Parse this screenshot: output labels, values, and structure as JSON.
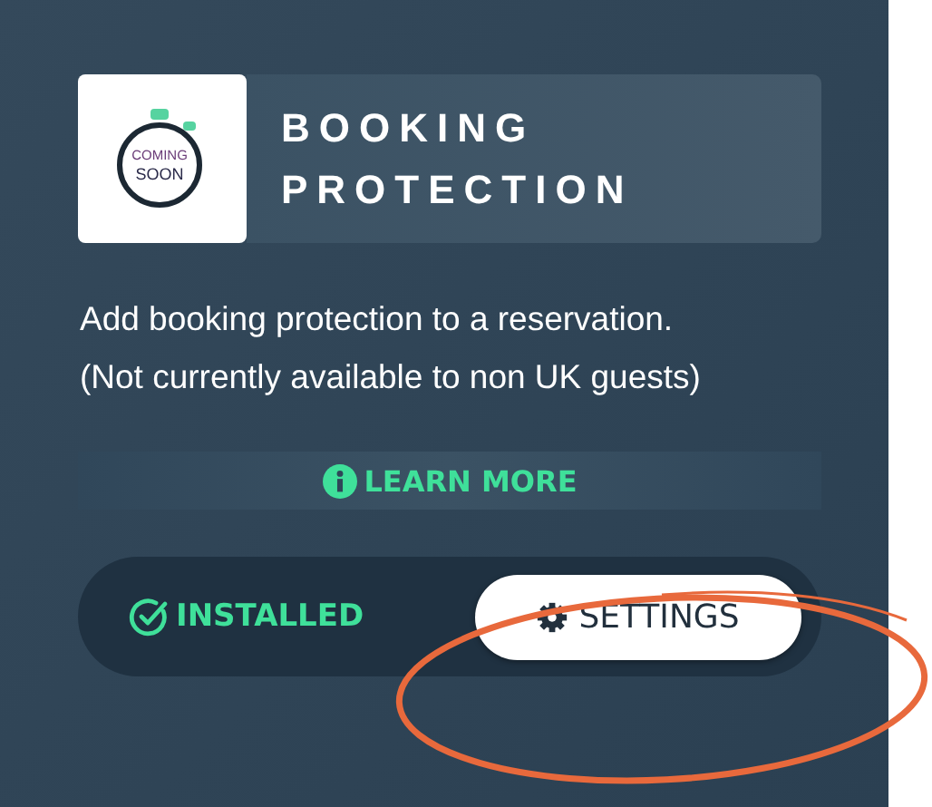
{
  "card": {
    "logo": {
      "line_1": "COMING",
      "line_2": "SOON"
    },
    "title": "BOOKING PROTECTION",
    "description": "Add booking protection to a reservation. (Not currently available to non UK guests)",
    "learn_more": {
      "label": "LEARN MORE"
    },
    "status": {
      "label": "INSTALLED"
    },
    "settings_button": {
      "label": "SETTINGS"
    }
  }
}
